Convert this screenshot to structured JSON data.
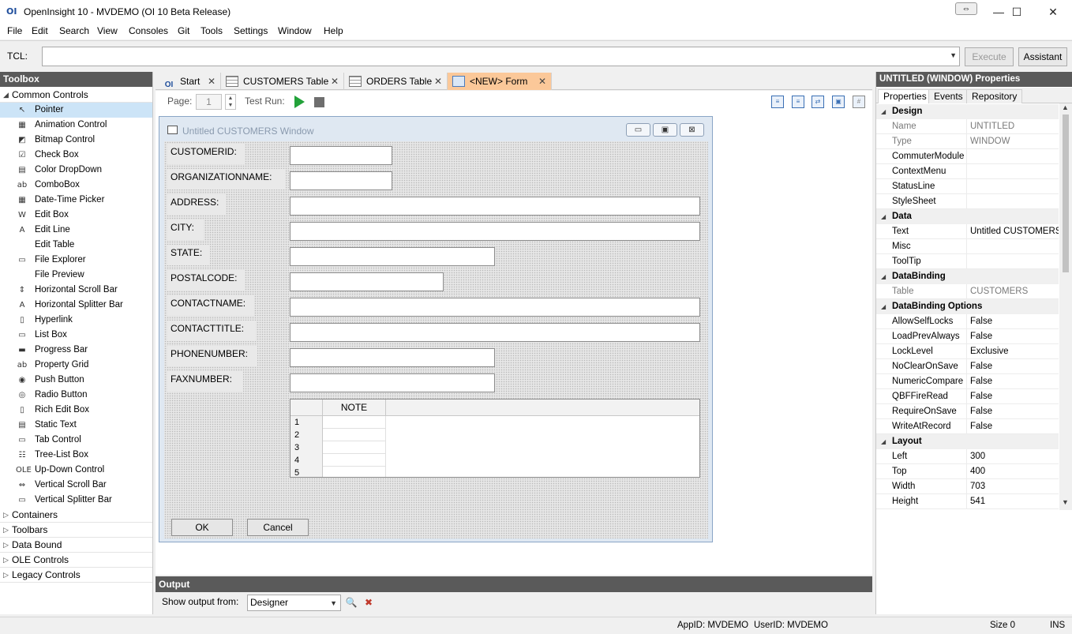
{
  "window": {
    "title": "OpenInsight 10 - MVDEMO (OI 10 Beta Release)",
    "logo": "OI",
    "minimize": "—",
    "maximize": "☐",
    "close": "✕",
    "resize_glyph": "⇔"
  },
  "menu": [
    "File",
    "Edit",
    "Search",
    "View",
    "Consoles",
    "Git",
    "Tools",
    "Settings",
    "Window",
    "Help"
  ],
  "tcl": {
    "label": "TCL:",
    "value": "",
    "execute": "Execute",
    "assistant": "Assistant"
  },
  "toolbox": {
    "title": "Toolbox",
    "common_group": "Common Controls",
    "items": [
      {
        "label": "Pointer",
        "icon": "pointer-icon",
        "glyph": "↖"
      },
      {
        "label": "Animation Control",
        "icon": "animation-icon",
        "glyph": "▦"
      },
      {
        "label": "Bitmap Control",
        "icon": "bitmap-icon",
        "glyph": "◩"
      },
      {
        "label": "Check Box",
        "icon": "checkbox-icon",
        "glyph": "☑"
      },
      {
        "label": "Color DropDown",
        "icon": "color-dropdown-icon",
        "glyph": "▤"
      },
      {
        "label": "ComboBox",
        "icon": "combobox-icon",
        "glyph": "ab"
      },
      {
        "label": "Date-Time Picker",
        "icon": "datetime-icon",
        "glyph": "▦"
      },
      {
        "label": "Edit Box",
        "icon": "editbox-icon",
        "glyph": "W"
      },
      {
        "label": "Edit Line",
        "icon": "editline-icon",
        "glyph": "A"
      },
      {
        "label": "Edit Table",
        "icon": "edittable-icon",
        "glyph": ""
      },
      {
        "label": "File Explorer",
        "icon": "file-explorer-icon",
        "glyph": "▭"
      },
      {
        "label": "File Preview",
        "icon": "file-preview-icon",
        "glyph": ""
      },
      {
        "label": "Horizontal Scroll Bar",
        "icon": "hscroll-icon",
        "glyph": "⇕"
      },
      {
        "label": "Horizontal Splitter Bar",
        "icon": "hsplitter-icon",
        "glyph": "A"
      },
      {
        "label": "Hyperlink",
        "icon": "hyperlink-icon",
        "glyph": "▯"
      },
      {
        "label": "List Box",
        "icon": "listbox-icon",
        "glyph": "▭"
      },
      {
        "label": "Progress Bar",
        "icon": "progressbar-icon",
        "glyph": "▬"
      },
      {
        "label": "Property Grid",
        "icon": "propertygrid-icon",
        "glyph": "ab"
      },
      {
        "label": "Push Button",
        "icon": "pushbutton-icon",
        "glyph": "◉"
      },
      {
        "label": "Radio Button",
        "icon": "radiobutton-icon",
        "glyph": "◎"
      },
      {
        "label": "Rich Edit Box",
        "icon": "richedit-icon",
        "glyph": "▯"
      },
      {
        "label": "Static Text",
        "icon": "statictext-icon",
        "glyph": "▤"
      },
      {
        "label": "Tab Control",
        "icon": "tabcontrol-icon",
        "glyph": "▭"
      },
      {
        "label": "Tree-List Box",
        "icon": "treelist-icon",
        "glyph": "☷"
      },
      {
        "label": "Up-Down Control",
        "icon": "updown-icon",
        "glyph": "OLE"
      },
      {
        "label": "Vertical Scroll Bar",
        "icon": "vscroll-icon",
        "glyph": "⇔"
      },
      {
        "label": "Vertical Splitter Bar",
        "icon": "vsplitter-icon",
        "glyph": "▭"
      }
    ],
    "groups": [
      "Containers",
      "Toolbars",
      "Data Bound",
      "OLE Controls",
      "Legacy Controls"
    ]
  },
  "tabs": [
    {
      "label": "Start",
      "icon": "oi-logo-icon",
      "close": "✕"
    },
    {
      "label": "CUSTOMERS Table",
      "icon": "table-icon",
      "close": "✕"
    },
    {
      "label": "ORDERS Table",
      "icon": "table-icon",
      "close": "✕"
    },
    {
      "label": "<NEW> Form",
      "icon": "form-icon",
      "close": "✕"
    }
  ],
  "form_toolbar": {
    "page_label": "Page:",
    "page_value": "1",
    "test_run_label": "Test Run:"
  },
  "design_window": {
    "title": "Untitled CUSTOMERS Window",
    "min": "▭",
    "max": "▣",
    "close": "⊠",
    "fields": [
      "CUSTOMERID:",
      "ORGANIZATIONNAME:",
      "ADDRESS:",
      "CITY:",
      "STATE:",
      "POSTALCODE:",
      "CONTACTNAME:",
      "CONTACTTITLE:",
      "PHONENUMBER:",
      "FAXNUMBER:"
    ],
    "table": {
      "column": "NOTE",
      "rows": [
        "1",
        "2",
        "3",
        "4",
        "5"
      ]
    },
    "ok_label": "OK",
    "cancel_label": "Cancel"
  },
  "output": {
    "title": "Output",
    "show_label": "Show output from:",
    "selected": "Designer"
  },
  "properties": {
    "title": "UNTITLED (WINDOW) Properties",
    "tabs": [
      "Properties",
      "Events",
      "Repository"
    ],
    "categories": [
      {
        "name": "Design",
        "rows": [
          {
            "name": "Name",
            "value": "UNTITLED",
            "readonly": true
          },
          {
            "name": "Type",
            "value": "WINDOW",
            "readonly": true
          },
          {
            "name": "CommuterModule",
            "value": ""
          },
          {
            "name": "ContextMenu",
            "value": ""
          },
          {
            "name": "StatusLine",
            "value": ""
          },
          {
            "name": "StyleSheet",
            "value": ""
          }
        ]
      },
      {
        "name": "Data",
        "rows": [
          {
            "name": "Text",
            "value": "Untitled CUSTOMERS"
          },
          {
            "name": "Misc",
            "value": ""
          },
          {
            "name": "ToolTip",
            "value": ""
          }
        ]
      },
      {
        "name": "DataBinding",
        "rows": [
          {
            "name": "Table",
            "value": "CUSTOMERS",
            "readonly": true
          }
        ]
      },
      {
        "name": "DataBinding Options",
        "rows": [
          {
            "name": "AllowSelfLocks",
            "value": "False"
          },
          {
            "name": "LoadPrevAlways",
            "value": "False"
          },
          {
            "name": "LockLevel",
            "value": "Exclusive"
          },
          {
            "name": "NoClearOnSave",
            "value": "False"
          },
          {
            "name": "NumericCompare",
            "value": "False"
          },
          {
            "name": "QBFFireRead",
            "value": "False"
          },
          {
            "name": "RequireOnSave",
            "value": "False"
          },
          {
            "name": "WriteAtRecord",
            "value": "False"
          }
        ]
      },
      {
        "name": "Layout",
        "rows": [
          {
            "name": "Left",
            "value": "300"
          },
          {
            "name": "Top",
            "value": "400"
          },
          {
            "name": "Width",
            "value": "703"
          },
          {
            "name": "Height",
            "value": "541"
          }
        ]
      }
    ]
  },
  "status": {
    "appid": "AppID: MVDEMO",
    "userid": "UserID: MVDEMO",
    "size": "Size 0",
    "ins": "INS"
  }
}
